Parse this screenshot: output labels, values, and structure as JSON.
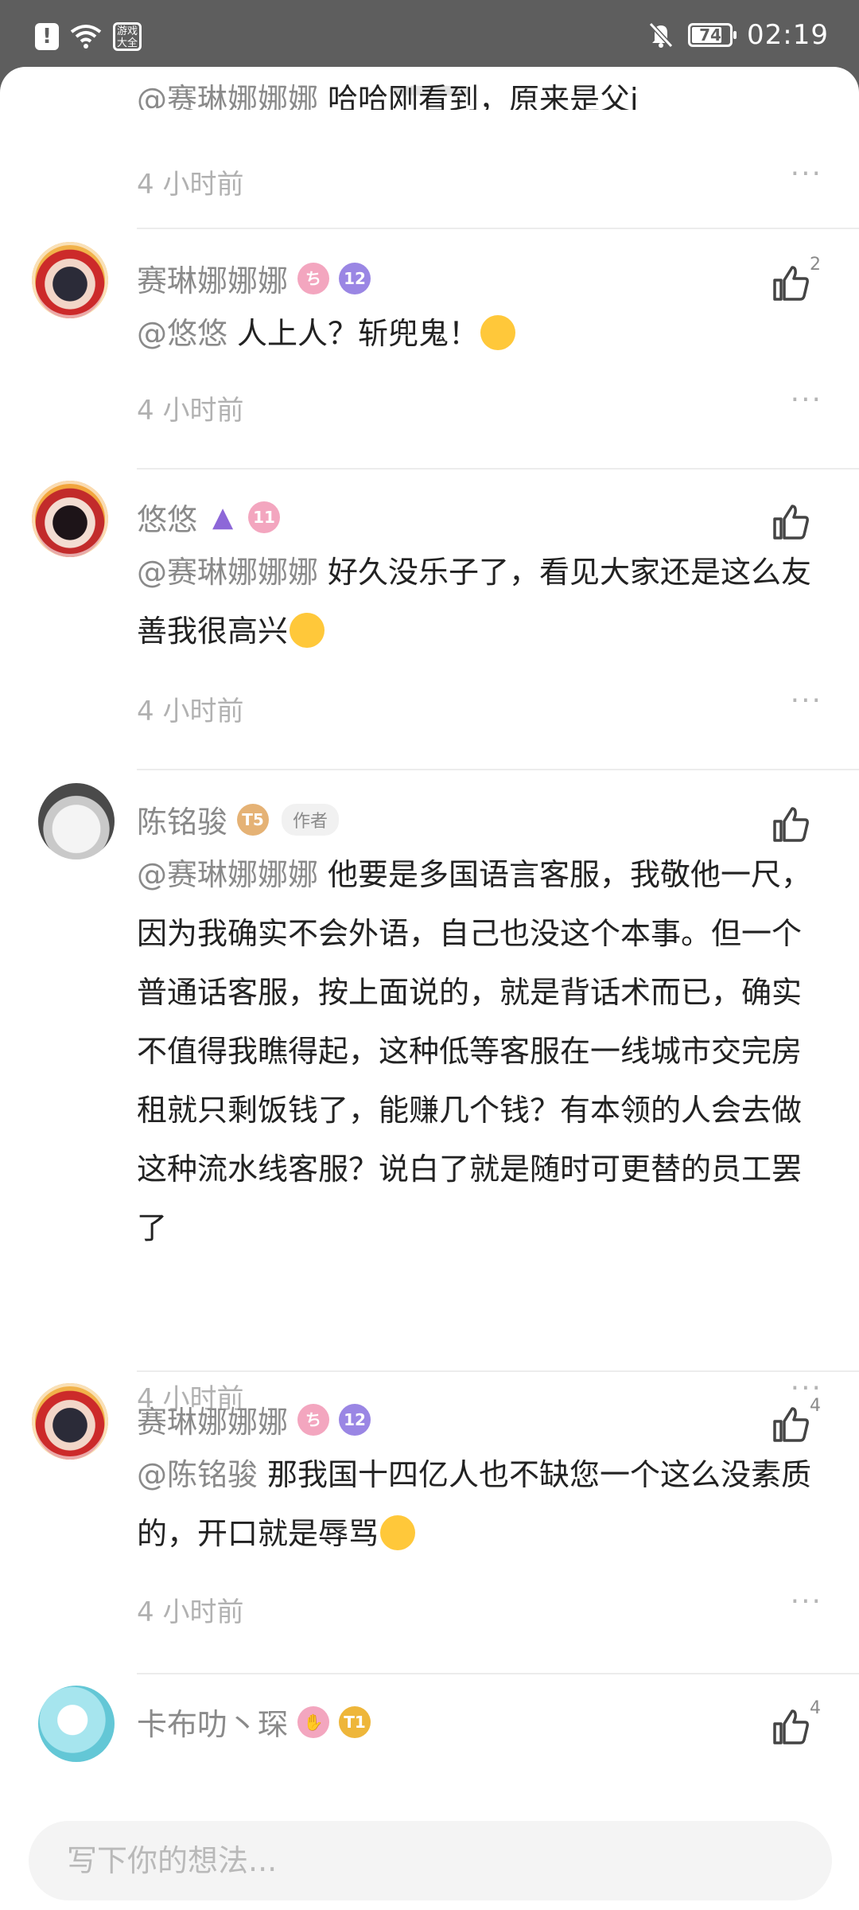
{
  "status_bar": {
    "alert_glyph": "!",
    "app_badge": "游戏大全",
    "battery": "74",
    "time": "02:19"
  },
  "partial_comment": {
    "mention": "@赛琳娜娜娜",
    "text": "哈哈刚看到，原来是父j",
    "time": "4 小时前"
  },
  "comments": [
    {
      "name": "赛琳娜娜娜",
      "badge1": "ち",
      "badge2": "12",
      "mention": "@悠悠",
      "text": "人上人？斩兜鬼！",
      "time": "4 小时前",
      "likes": "2"
    },
    {
      "name": "悠悠",
      "badge2": "11",
      "mention": "@赛琳娜娜娜",
      "text": "好久没乐子了，看见大家还是这么友善我很高兴",
      "time": "4 小时前",
      "likes": ""
    },
    {
      "name": "陈铭骏",
      "badge1": "T5",
      "author_tag": "作者",
      "mention": "@赛琳娜娜娜",
      "text": "他要是多国语言客服，我敬他一尺，因为我确实不会外语，自己也没这个本事。但一个普通话客服，按上面说的，就是背话术而已，确实不值得我瞧得起，这种低等客服在一线城市交完房租就只剩饭钱了，能赚几个钱？有本领的人会去做这种流水线客服？说白了就是随时可更替的员工罢了",
      "time": "4 小时前",
      "likes": ""
    },
    {
      "name": "赛琳娜娜娜",
      "badge1": "ち",
      "badge2": "12",
      "mention": "@陈铭骏",
      "text": "那我国十四亿人也不缺您一个这么没素质的，开口就是辱骂",
      "time": "4 小时前",
      "likes": "4"
    },
    {
      "name": "卡布叻丶琛",
      "badge2": "T1",
      "likes": "4"
    }
  ],
  "dots_label": "···",
  "input": {
    "placeholder": "写下你的想法..."
  },
  "colors": {
    "accent_gray": "#8a8a8a",
    "time_gray": "#b1b1b1"
  }
}
